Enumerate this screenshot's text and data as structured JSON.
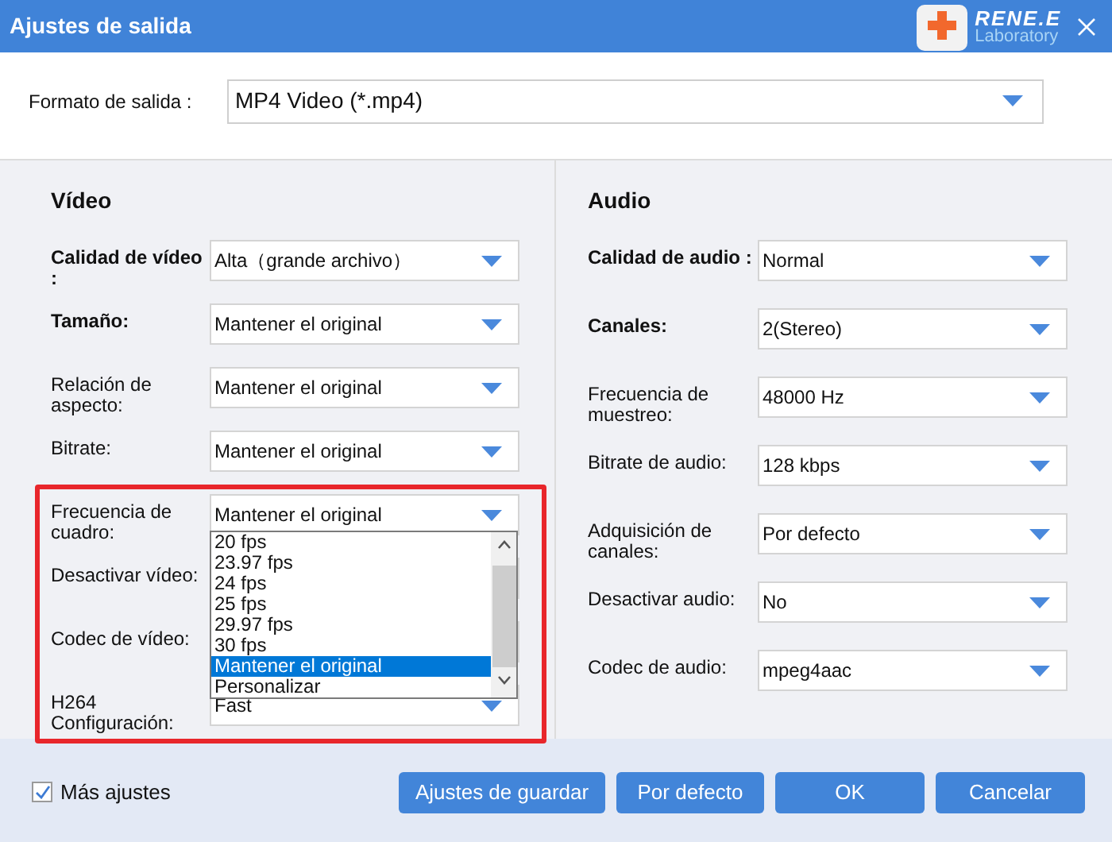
{
  "window": {
    "title": "Ajustes de salida"
  },
  "logo": {
    "name": "RENE.E",
    "subtitle": "Laboratory"
  },
  "output_format": {
    "label": "Formato de salida :",
    "value": "MP4 Video (*.mp4)"
  },
  "video": {
    "title": "Vídeo",
    "fields": [
      {
        "label": "Calidad de vídeo :",
        "bold": true,
        "value": "Alta（grande archivo）"
      },
      {
        "label": "Tamaño:",
        "bold": true,
        "value": "Mantener el original"
      },
      {
        "label": "Relación de aspecto:",
        "bold": false,
        "value": "Mantener el original"
      },
      {
        "label": "Bitrate:",
        "bold": false,
        "value": "Mantener el original"
      },
      {
        "label": "Frecuencia de cuadro:",
        "bold": false,
        "value": "Mantener el original",
        "expanded": true,
        "options": [
          {
            "label": "20 fps",
            "selected": false
          },
          {
            "label": "23.97 fps",
            "selected": false
          },
          {
            "label": "24 fps",
            "selected": false
          },
          {
            "label": "25 fps",
            "selected": false
          },
          {
            "label": "29.97 fps",
            "selected": false
          },
          {
            "label": "30 fps",
            "selected": false
          },
          {
            "label": "Mantener el original",
            "selected": true
          },
          {
            "label": "Personalizar",
            "selected": false
          }
        ]
      },
      {
        "label": "Desactivar vídeo:",
        "bold": false
      },
      {
        "label": "Codec de vídeo:",
        "bold": false
      },
      {
        "label": "H264 Configuración:",
        "bold": false,
        "value": "Fast"
      }
    ]
  },
  "audio": {
    "title": "Audio",
    "fields": [
      {
        "label": "Calidad de audio :",
        "bold": true,
        "value": "Normal"
      },
      {
        "label": "Canales:",
        "bold": true,
        "value": "2(Stereo)"
      },
      {
        "label": "Frecuencia de muestreo:",
        "bold": false,
        "value": "48000 Hz"
      },
      {
        "label": "Bitrate de audio:",
        "bold": false,
        "value": "128 kbps"
      },
      {
        "label": "Adquisición de canales:",
        "bold": false,
        "value": "Por defecto"
      },
      {
        "label": "Desactivar audio:",
        "bold": false,
        "value": "No"
      },
      {
        "label": "Codec de audio:",
        "bold": false,
        "value": "mpeg4aac"
      }
    ]
  },
  "more_settings": {
    "label": "Más ajustes",
    "checked": true
  },
  "buttons": [
    "Ajustes de guardar",
    "Por defecto",
    "OK",
    "Cancelar"
  ]
}
